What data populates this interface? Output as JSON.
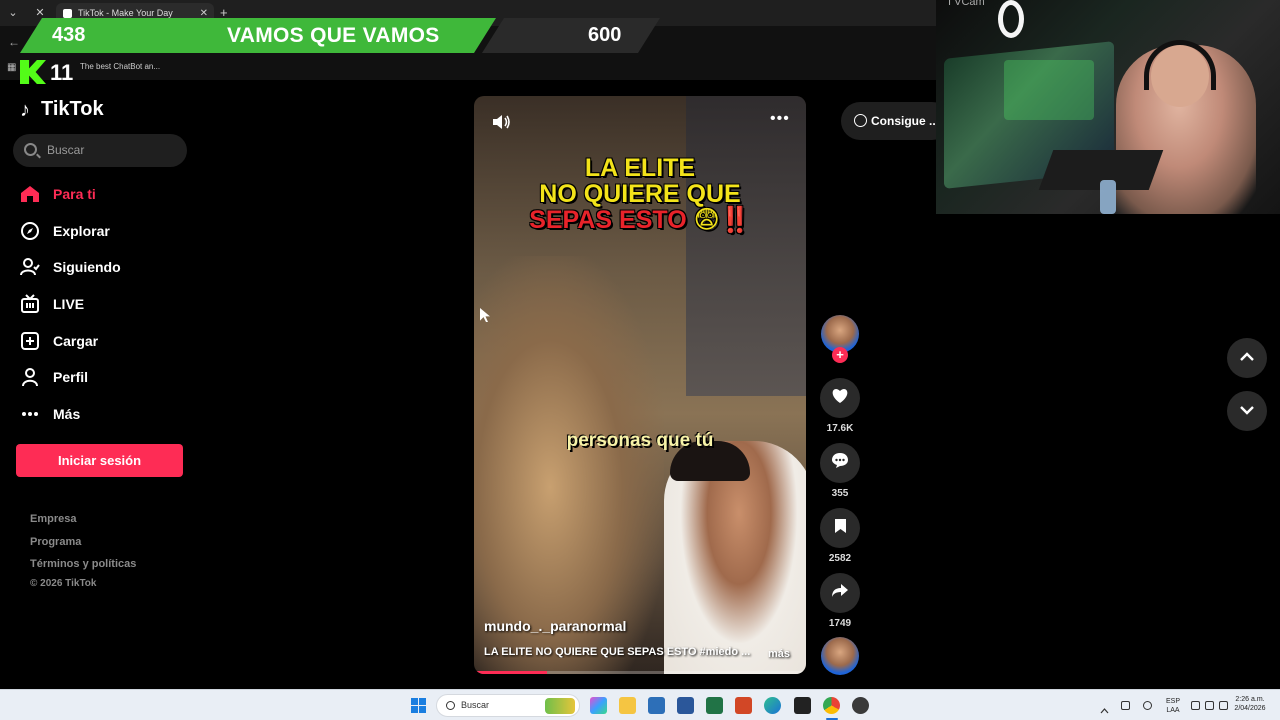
{
  "browser": {
    "tab_title": "TikTok - Make Your Day",
    "new_tab": "+",
    "bookmark_label": "The best ChatBot an..."
  },
  "overlay": {
    "left_count": "438",
    "message": "VAMOS QUE VAMOS",
    "right_count": "600",
    "viewers": "11",
    "webcam_text": "I VCam"
  },
  "sidebar": {
    "brand": "TikTok",
    "search_placeholder": "Buscar",
    "nav": [
      {
        "label": "Para ti",
        "icon": "home-icon",
        "active": true
      },
      {
        "label": "Explorar",
        "icon": "compass-icon"
      },
      {
        "label": "Siguiendo",
        "icon": "following-icon"
      },
      {
        "label": "LIVE",
        "icon": "live-icon"
      },
      {
        "label": "Cargar",
        "icon": "upload-icon"
      },
      {
        "label": "Perfil",
        "icon": "profile-icon"
      },
      {
        "label": "Más",
        "icon": "more-icon"
      }
    ],
    "login_label": "Iniciar sesión",
    "footer_links": [
      "Empresa",
      "Programa",
      "Términos y políticas"
    ],
    "copyright": "© 2026 TikTok"
  },
  "video": {
    "caption_line1": "LA ELITE",
    "caption_line2": "NO QUIERE QUE",
    "caption_line3": "SEPAS ESTO",
    "caption_emoji": "😨‼️",
    "subtitle": "personas que tú",
    "author": "mundo_._paranormal",
    "description": "LA ELITE NO QUIERE QUE SEPAS ESTO #miedo ...",
    "more_label": "más",
    "progress": 0.22
  },
  "actions": {
    "likes": "17.6K",
    "comments": "355",
    "saves": "2582",
    "shares": "1749"
  },
  "get_coins": "Consigue ...",
  "taskbar": {
    "search_label": "Buscar",
    "lang": "ESP\nLAA",
    "time": "2:26 a.m.",
    "date": "2/04/2026"
  },
  "colors": {
    "accent": "#fe2c55",
    "banner_green": "#3fb83a",
    "kick_green": "#53fc18"
  }
}
